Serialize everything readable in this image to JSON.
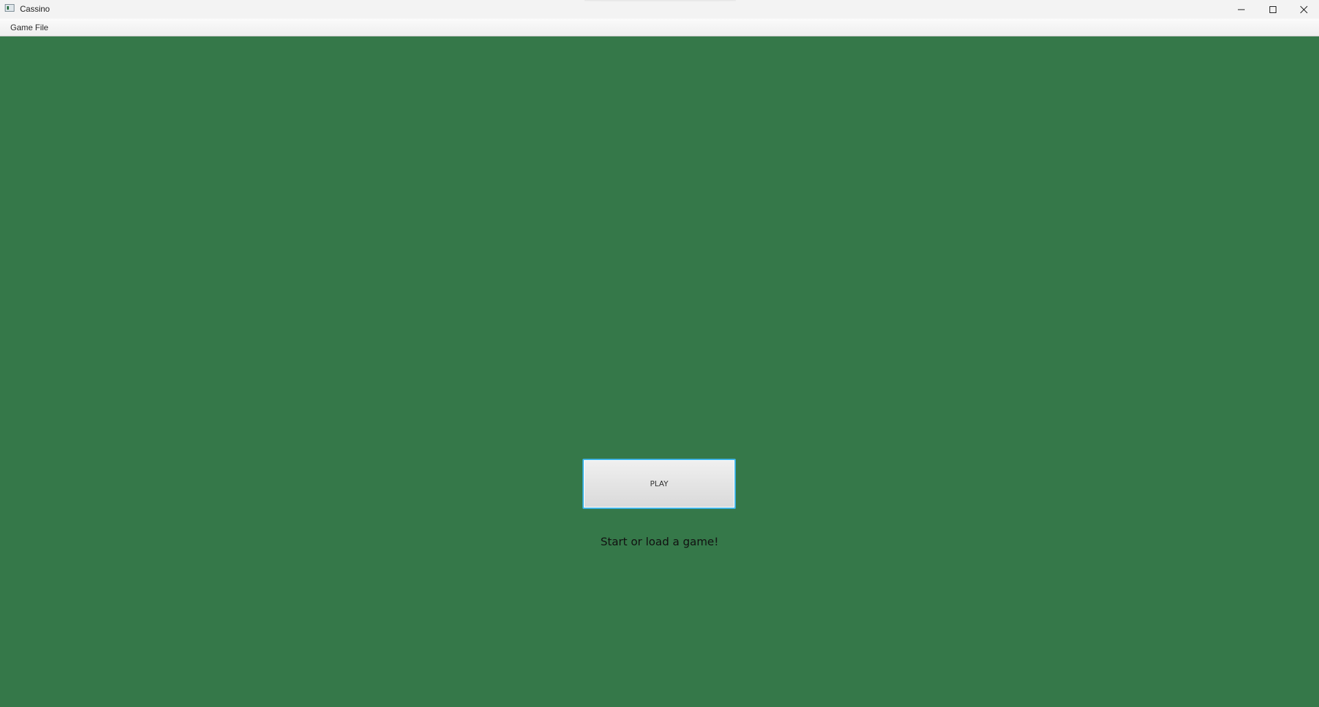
{
  "window": {
    "title": "Cassino",
    "background_color": "#357849",
    "controls": {
      "minimize_icon": "minimize-icon",
      "maximize_icon": "maximize-icon",
      "close_icon": "close-icon"
    }
  },
  "menubar": {
    "items": [
      {
        "label": "Game File"
      }
    ]
  },
  "main": {
    "play_button_label": "PLAY",
    "status_message": "Start or load a game!",
    "accent_focus_color": "#3fb4e8"
  }
}
